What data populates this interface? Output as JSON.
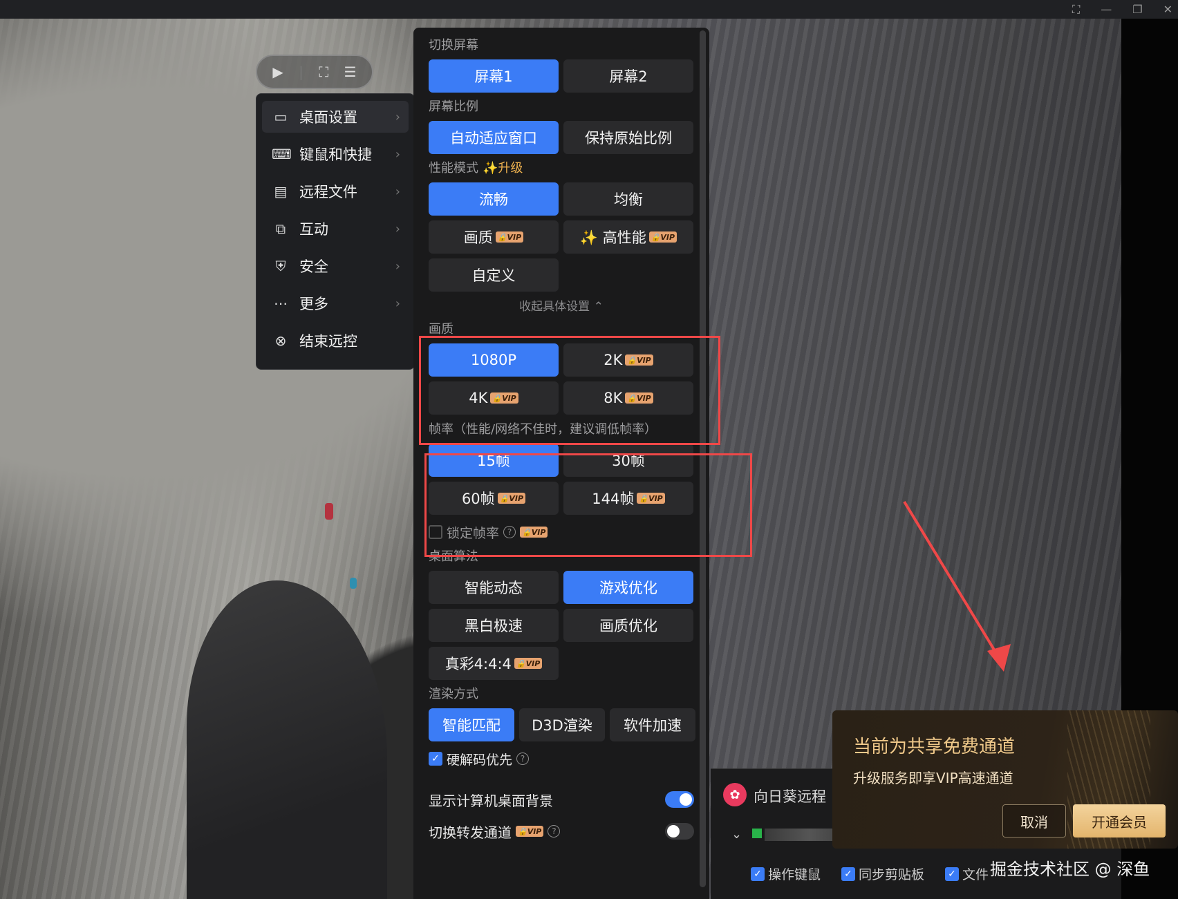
{
  "colors": {
    "accent": "#3b7cf6",
    "vip_badge": "#e7a36f",
    "annotation_red": "#ef4848",
    "popup_gold": "#f0c98a"
  },
  "toolbar_pill": {
    "icons": [
      "cursor-icon",
      "fullscreen-icon",
      "settings-icon"
    ]
  },
  "menu": {
    "items": [
      {
        "label": "桌面设置",
        "icon": "monitor-icon"
      },
      {
        "label": "键鼠和快捷",
        "icon": "keyboard-icon"
      },
      {
        "label": "远程文件",
        "icon": "folder-icon"
      },
      {
        "label": "互动",
        "icon": "interact-icon"
      },
      {
        "label": "安全",
        "icon": "shield-icon"
      },
      {
        "label": "更多",
        "icon": "more-icon"
      },
      {
        "label": "结束远控",
        "icon": "close-circle-icon"
      }
    ]
  },
  "panel": {
    "screen_switch": {
      "title": "切换屏幕",
      "options": [
        "屏幕1",
        "屏幕2"
      ],
      "selected": "屏幕1"
    },
    "aspect": {
      "title": "屏幕比例",
      "options": [
        "自动适应窗口",
        "保持原始比例"
      ],
      "selected": "自动适应窗口"
    },
    "performance": {
      "title": "性能模式",
      "upgrade": "✨升级",
      "options": [
        "流畅",
        "均衡",
        "画质",
        "✨ 高性能",
        "自定义"
      ],
      "selected": "流畅"
    },
    "collapse_label": "收起具体设置 ⌃",
    "quality": {
      "title": "画质",
      "options": [
        "1080P",
        "2K",
        "4K",
        "8K"
      ],
      "selected": "1080P"
    },
    "framerate": {
      "title": "帧率（性能/网络不佳时，建议调低帧率）",
      "options": [
        "15帧",
        "30帧",
        "60帧",
        "144帧"
      ],
      "selected": "15帧"
    },
    "lock_fps": {
      "label": "锁定帧率",
      "checked": false
    },
    "algorithm": {
      "title": "桌面算法",
      "options": [
        "智能动态",
        "游戏优化",
        "黑白极速",
        "画质优化",
        "真彩4:4:4"
      ],
      "selected": "游戏优化"
    },
    "render": {
      "title": "渲染方式",
      "options": [
        "智能匹配",
        "D3D渲染",
        "软件加速"
      ],
      "selected": "智能匹配"
    },
    "hw_decode": {
      "label": "硬解码优先",
      "checked": true
    },
    "show_bg": {
      "label": "显示计算机桌面背景",
      "on": true
    },
    "relay": {
      "label": "切换转发通道",
      "on": false
    },
    "vip_text": "VIP"
  },
  "client": {
    "name": "向日葵远程",
    "checks": [
      "操作键鼠",
      "同步剪贴板",
      "文件"
    ]
  },
  "popup": {
    "title": "当前为共享免费通道",
    "subtitle": "升级服务即享VIP高速通道",
    "cancel": "取消",
    "open": "开通会员"
  },
  "watermark": "掘金技术社区 @ 深鱼"
}
